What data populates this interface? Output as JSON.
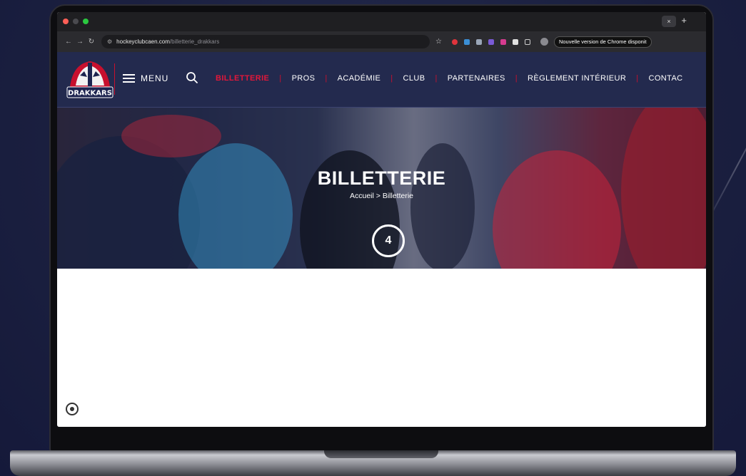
{
  "browser": {
    "tab_close": "×",
    "tab_new": "+",
    "url_host": "hockeyclubcaen.com",
    "url_path": "/billetterie_drakkars",
    "update_notice": "Nouvelle version de Chrome disponit"
  },
  "header": {
    "logo_text": "DRAKKARS",
    "menu_label": "MENU",
    "nav": [
      {
        "label": "BILLETTERIE",
        "active": true
      },
      {
        "label": "PROS"
      },
      {
        "label": "ACADÉMIE"
      },
      {
        "label": "CLUB"
      },
      {
        "label": "PARTENAIRES"
      },
      {
        "label": "RÈGLEMENT INTÉRIEUR"
      },
      {
        "label": "CONTAC"
      }
    ],
    "separator": "|"
  },
  "hero": {
    "title": "BILLETTERIE",
    "breadcrumb": "Accueil > Billetterie",
    "step_badge": "4"
  },
  "colors": {
    "navy": "#232a4e",
    "accent_red": "#e3173a",
    "separator_red": "#c8102e"
  },
  "icons": [
    "hamburger-icon",
    "search-icon",
    "accessibility-icon",
    "star-icon"
  ]
}
